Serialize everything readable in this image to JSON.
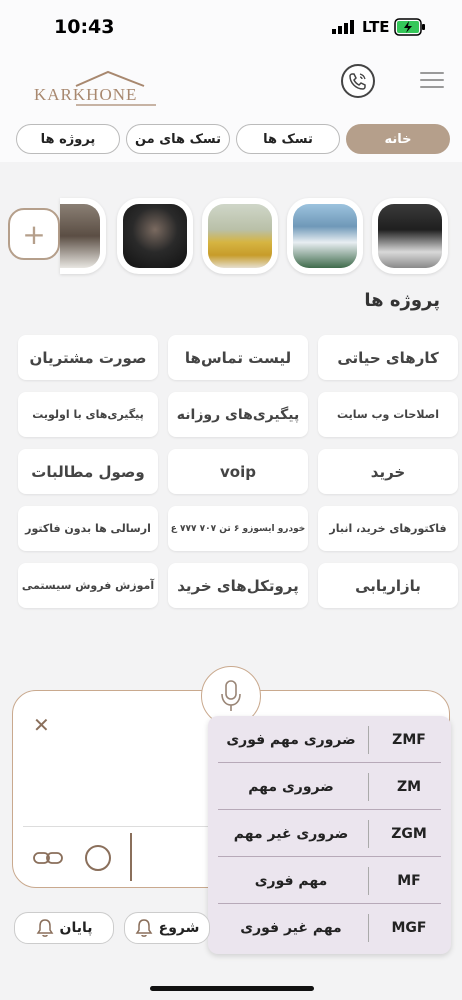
{
  "status": {
    "time": "10:43",
    "network": "LTE"
  },
  "header": {
    "logo_text": "KARKHONE"
  },
  "tabs": [
    {
      "label": "خانه"
    },
    {
      "label": "تسک ها"
    },
    {
      "label": "تسک های من"
    },
    {
      "label": "پروژه ها"
    }
  ],
  "projects": {
    "title": "پروژه ها",
    "items": [
      "کارهای حیاتی",
      "لیست تماس‌ها",
      "صورت مشتریان",
      "اصلاحات وب سایت",
      "پیگیری‌های روزانه",
      "پیگیری‌های با اولویت",
      "خرید",
      "voip",
      "وصول مطالبات",
      "فاکتورهای خرید، انبار",
      "خودرو ایسوزو ۶ تن ۷۰۷ ۷۷۷ ع",
      "ارسالی ها بدون فاکتور",
      "بازاریابی",
      "پروتکل‌های خرید",
      "آموزش فروش سیستمی"
    ]
  },
  "priority_menu": [
    {
      "code": "ZMF",
      "label": "ضروری مهم فوری"
    },
    {
      "code": "ZM",
      "label": "ضروری مهم"
    },
    {
      "code": "ZGM",
      "label": "ضروری غیر مهم"
    },
    {
      "code": "MF",
      "label": "مهم فوری"
    },
    {
      "code": "MGF",
      "label": "مهم غیر فوری"
    }
  ],
  "bottom": {
    "end_label": "پایان",
    "start_label": "شروع"
  },
  "colors": {
    "accent": "#b59f8b",
    "menu_bg": "#ebe5ee"
  }
}
